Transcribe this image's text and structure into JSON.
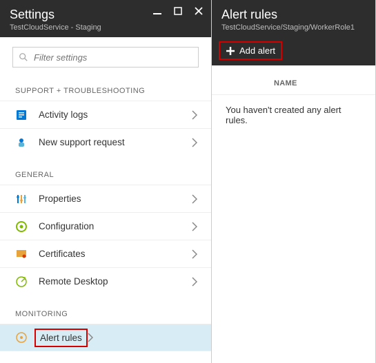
{
  "left": {
    "title": "Settings",
    "subtitle": "TestCloudService - Staging",
    "search_placeholder": "Filter settings",
    "sections": {
      "support": {
        "label": "SUPPORT + TROUBLESHOOTING",
        "items": [
          {
            "label": "Activity logs"
          },
          {
            "label": "New support request"
          }
        ]
      },
      "general": {
        "label": "GENERAL",
        "items": [
          {
            "label": "Properties"
          },
          {
            "label": "Configuration"
          },
          {
            "label": "Certificates"
          },
          {
            "label": "Remote Desktop"
          }
        ]
      },
      "monitoring": {
        "label": "MONITORING",
        "items": [
          {
            "label": "Alert rules"
          }
        ]
      }
    }
  },
  "right": {
    "title": "Alert rules",
    "subtitle": "TestCloudService/Staging/WorkerRole1",
    "add_label": "Add alert",
    "column_name": "NAME",
    "empty_text": "You haven't created any alert rules."
  }
}
